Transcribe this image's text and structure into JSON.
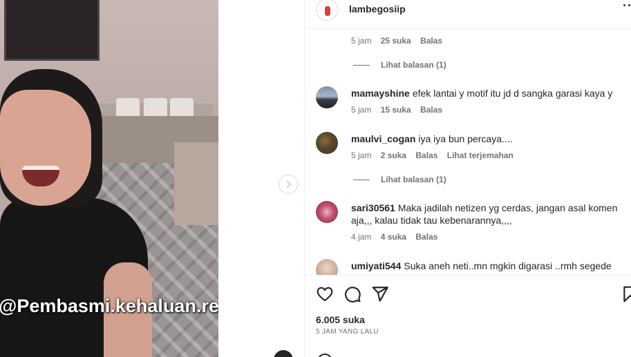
{
  "post": {
    "username": "lambegosiip",
    "more_label": "···",
    "watermark": "@Pembasmi.kehaluan.reall"
  },
  "comments": [
    {
      "meta": {
        "time": "5 jam",
        "likes": "25 suka",
        "reply": "Balas"
      }
    },
    {
      "view_replies": "Lihat balasan (1)"
    },
    {
      "username": "mamayshine",
      "text": "efek lantai y motif itu jd d sangka garasi kaya y",
      "meta": {
        "time": "5 jam",
        "likes": "15 suka",
        "reply": "Balas"
      }
    },
    {
      "username": "maulvi_cogan",
      "text": "iya iya bun percaya....",
      "meta": {
        "time": "5 jam",
        "likes": "2 suka",
        "reply": "Balas",
        "translate": "Lihat terjemahan"
      }
    },
    {
      "view_replies": "Lihat balasan (1)"
    },
    {
      "username": "sari30561",
      "text": "Maka jadilah netizen yg cerdas, jangan asal komen aja,,, kalau tidak tau kebenarannya,,,,",
      "meta": {
        "time": "4 jam",
        "likes": "4 suka",
        "reply": "Balas"
      }
    },
    {
      "username": "umiyati544",
      "text": "Suka aneh neti..mn mgkin digarasi ..rmh segede"
    }
  ],
  "actions": {
    "likes_count": "6.005 suka",
    "time_ago": "5 JAM YANG LALU"
  },
  "icons": {
    "like": "heart-icon",
    "comment": "comment-icon",
    "share": "send-icon",
    "save": "bookmark-icon",
    "next": "chevron-right-icon"
  },
  "colors": {
    "text": "#262626",
    "secondary": "#737373",
    "divider": "#efefef"
  }
}
